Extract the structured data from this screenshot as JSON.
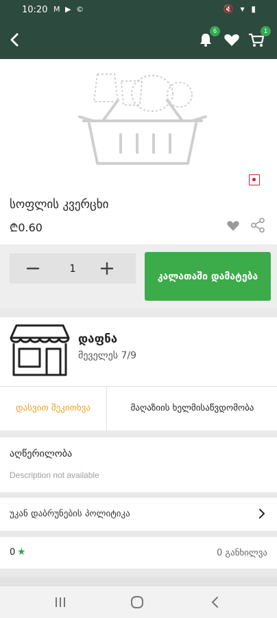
{
  "status_bar": {
    "time": "10:20",
    "left_icons": "M ▶ ©",
    "right_icons": "🔇 ▾ ▮"
  },
  "app_bar": {
    "notifications_badge": "6",
    "cart_badge": "1"
  },
  "product": {
    "name": "სოფლის კვერცხი",
    "price": "₾0.60"
  },
  "quantity": {
    "value": "1"
  },
  "actions": {
    "add_to_cart": "კალათაში დამატება"
  },
  "store": {
    "name": "დაფნა",
    "address": "მეველეს 7/9",
    "tab_question": "დასვით შეკითხვა",
    "tab_availability": "მაღაზიის ხელმისაწვდომობა"
  },
  "description": {
    "title": "აღწერილობა",
    "text": "Description not available"
  },
  "return_policy": {
    "label": "უკან დაბრუნების პოლიტიკა"
  },
  "rating": {
    "value": "0",
    "star": "★",
    "reviews": "0 განხილვა"
  },
  "colors": {
    "header": "#2c4a3e",
    "primary_green": "#3cab4a",
    "accent_orange": "#f0a020",
    "star_green": "#2fa84f"
  },
  "icons": [
    "back-arrow-icon",
    "bell-icon",
    "heart-icon",
    "cart-icon",
    "flag-icon",
    "share-icon",
    "minus-icon",
    "plus-icon",
    "store-icon",
    "chevron-right-icon",
    "star-icon"
  ]
}
